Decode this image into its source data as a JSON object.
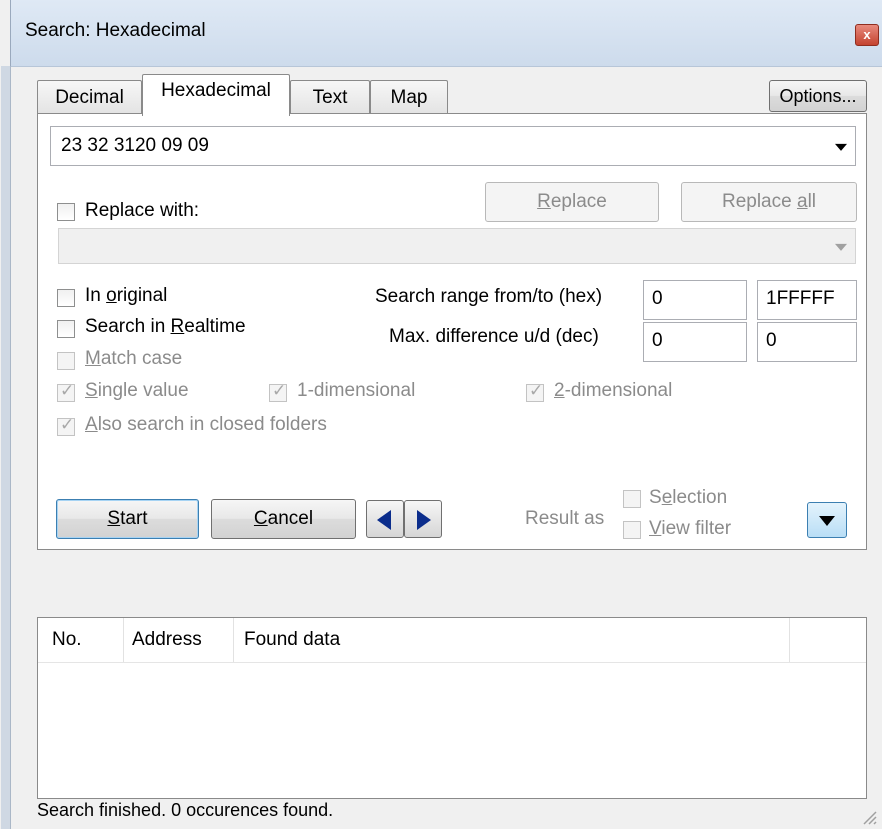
{
  "window": {
    "title": "Search: Hexadecimal",
    "close_label": "x"
  },
  "tabs": [
    {
      "label": "Decimal",
      "active": false
    },
    {
      "label": "Hexadecimal",
      "active": true
    },
    {
      "label": "Text",
      "active": false
    },
    {
      "label": "Map",
      "active": false
    }
  ],
  "options_button": "Options...",
  "search": {
    "value": "23 32 3120 09 09"
  },
  "replace": {
    "checkbox_label": "Replace with:",
    "replace_button": {
      "pre": "",
      "ul": "R",
      "post": "eplace"
    },
    "replace_all_button": {
      "pre": "Replace ",
      "ul": "a",
      "post": "ll"
    },
    "value": ""
  },
  "options": {
    "in_original": {
      "pre": "In ",
      "ul": "o",
      "post": "riginal"
    },
    "search_realtime": {
      "pre": "Search in ",
      "ul": "R",
      "post": "ealtime"
    },
    "match_case": {
      "pre": "",
      "ul": "M",
      "post": "atch case"
    },
    "single_value": {
      "pre": "",
      "ul": "S",
      "post": "ingle value"
    },
    "one_dimensional": "1-dimensional",
    "two_dimensional": {
      "pre": "",
      "ul": "2",
      "post": "-dimensional"
    },
    "closed_folders": {
      "pre": "",
      "ul": "A",
      "post": "lso search in closed folders"
    }
  },
  "range": {
    "label": "Search range from/to (hex)",
    "from": "0",
    "to": "1FFFFF",
    "diff_label": "Max. difference u/d (dec)",
    "diff_up": "0",
    "diff_down": "0"
  },
  "actions": {
    "start": {
      "pre": "",
      "ul": "S",
      "post": "tart"
    },
    "cancel": {
      "pre": "",
      "ul": "C",
      "post": "ancel"
    },
    "result_as": "Result as",
    "selection": {
      "pre": "S",
      "ul": "e",
      "post": "lection"
    },
    "view_filter": {
      "pre": "",
      "ul": "V",
      "post": "iew filter"
    }
  },
  "results": {
    "columns": [
      "No.",
      "Address",
      "Found data"
    ]
  },
  "status": "Search finished. 0 occurences found."
}
